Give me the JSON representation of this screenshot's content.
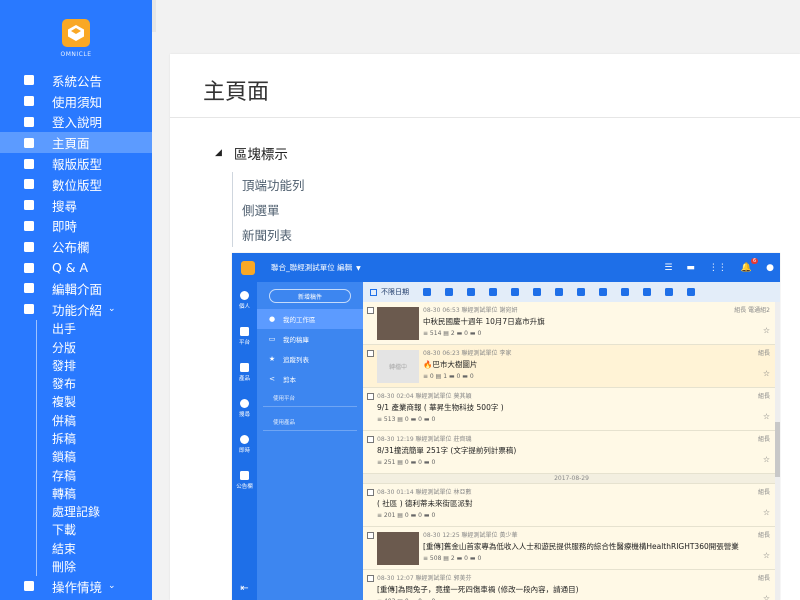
{
  "sidebar": {
    "brand": "OMNICLE",
    "items": [
      {
        "label": "系統公告",
        "icon": "announcement-icon"
      },
      {
        "label": "使用須知",
        "icon": "info-icon"
      },
      {
        "label": "登入說明",
        "icon": "login-icon"
      },
      {
        "label": "主頁面",
        "icon": "home-icon",
        "active": true
      },
      {
        "label": "報版版型",
        "icon": "layout-icon"
      },
      {
        "label": "數位版型",
        "icon": "grid-icon"
      },
      {
        "label": "搜尋",
        "icon": "globe-icon"
      },
      {
        "label": "即時",
        "icon": "fire-icon"
      },
      {
        "label": "公布欄",
        "icon": "board-icon"
      },
      {
        "label": "Q & A",
        "icon": "calendar-icon"
      },
      {
        "label": "編輯介面",
        "icon": "pen-icon"
      },
      {
        "label": "功能介紹",
        "icon": "wrench-icon",
        "expanded": true
      }
    ],
    "sub_items": [
      "出手",
      "分版",
      "發排",
      "發布",
      "複製",
      "併稿",
      "拆稿",
      "鎖稿",
      "存稿",
      "轉稿",
      "處理記錄",
      "下載",
      "結束",
      "刪除"
    ],
    "last_item": {
      "label": "操作情境",
      "icon": "chat-icon"
    }
  },
  "main": {
    "title": "主頁面",
    "section": "區塊標示",
    "toc": [
      "頂端功能列",
      "側選單",
      "新聞列表"
    ]
  },
  "screenshot": {
    "unit_selector": "聯合_聯經測試單位 編輯",
    "notif_count": "6",
    "rail": [
      "個人",
      "平台",
      "產品",
      "搜尋",
      "即時",
      "公告欄"
    ],
    "new_button": "新增稿件",
    "panel_items": [
      "我的工作區",
      "我的稿庫",
      "追蹤列表",
      "剪本"
    ],
    "panel_sections": [
      "使用平台",
      "使用產品"
    ],
    "date_filter": "不限日期",
    "date_separator": "2017-08-29",
    "rows": [
      {
        "meta": "08-30 06:53 聯經測試單位 謝宛妍",
        "title": "中秋民國慶十週年 10月7日嘉市升旗",
        "stats": "≡ 514  ▤ 2  ▬ 0  ▬ 0",
        "tag": "組長 電通組2",
        "thumb": "photo"
      },
      {
        "meta": "08-30 06:23 聯經測試單位 李家",
        "title": "🔥巴市大樹圖片",
        "stats": "≡ 0  ▤ 1  ▬ 0  ▬ 0",
        "tag": "組長",
        "thumb": "placeholder",
        "thumb_text": "轉檔中"
      },
      {
        "meta": "08-30 02:04 聯經測試單位 莫其穎",
        "title": "9/1 產業商報 ( 華昇生物科技 500字 )",
        "stats": "≡ 513  ▤ 0  ▬ 0  ▬ 0",
        "tag": "組長",
        "thumb": "none"
      },
      {
        "meta": "08-30 12:19 聯經測試單位 莊齊璣",
        "title": "8/31撞流簡單 251字 (文字提前列計票稿)",
        "stats": "≡ 251  ▤ 0  ▬ 0  ▬ 0",
        "tag": "組長",
        "thumb": "none"
      },
      {
        "meta": "08-30 01:14 聯經測試單位 林亞數",
        "title": "( 社區 ) 德利蒂未來街區派對",
        "stats": "≡ 201  ▤ 0  ▬ 0  ▬ 0",
        "tag": "組長",
        "thumb": "none"
      },
      {
        "meta": "08-30 12:25 聯經測試單位 黃少華",
        "title": "[重傳]舊金山首家專為低收入人士和遊民提供服務的綜合性醫療機構HealthRIGHT360開張營業",
        "stats": "≡ 508  ▤ 2  ▬ 0  ▬ 0",
        "tag": "組長",
        "thumb": "photo"
      },
      {
        "meta": "08-30 12:07 聯經測試單位 郭美芬",
        "title": "[重傳]為問兔子，竟撞一死四傷車禍 (修改一段內容，請通目)",
        "stats": "≡ 403  ▤ 0  ▬ 0  ▬ 0",
        "tag": "組長",
        "thumb": "none"
      }
    ]
  }
}
